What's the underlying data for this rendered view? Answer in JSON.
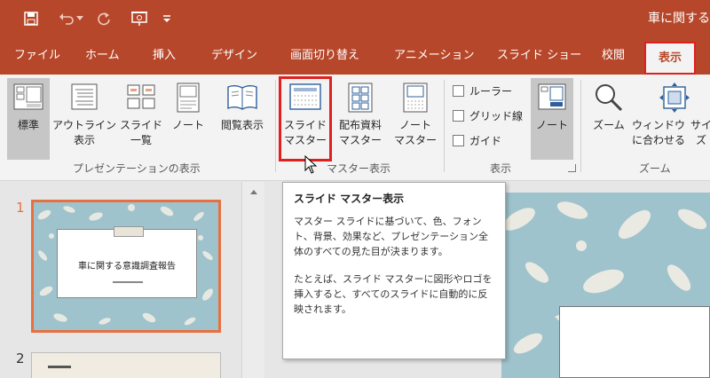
{
  "titlebar": {
    "doc_title": "車に関する",
    "qat": [
      "save-icon",
      "undo-icon",
      "redo-icon",
      "present-icon",
      "customize-icon"
    ]
  },
  "tabs": [
    {
      "label": "ファイル"
    },
    {
      "label": "ホーム"
    },
    {
      "label": "挿入"
    },
    {
      "label": "デザイン"
    },
    {
      "label": "画面切り替え"
    },
    {
      "label": "アニメーション"
    },
    {
      "label": "スライド ショー"
    },
    {
      "label": "校閲"
    },
    {
      "label": "表示",
      "active": true
    }
  ],
  "ribbon": {
    "presentation_view": {
      "label": "プレゼンテーションの表示",
      "buttons": [
        {
          "line1": "標準",
          "line2": "",
          "selected": true
        },
        {
          "line1": "アウトライン",
          "line2": "表示"
        },
        {
          "line1": "スライド",
          "line2": "一覧"
        },
        {
          "line1": "ノート",
          "line2": ""
        },
        {
          "line1": "閲覧表示",
          "line2": ""
        }
      ]
    },
    "master_view": {
      "label": "マスター表示",
      "buttons": [
        {
          "line1": "スライド",
          "line2": "マスター",
          "highlight": true
        },
        {
          "line1": "配布資料",
          "line2": "マスター"
        },
        {
          "line1": "ノート",
          "line2": "マスター"
        }
      ]
    },
    "show": {
      "label": "表示",
      "checkboxes": [
        "ルーラー",
        "グリッド線",
        "ガイド"
      ],
      "notes_button": "ノート"
    },
    "zoom": {
      "label": "ズーム",
      "zoom_button": "ズーム",
      "fit_line1": "ウィンドウ",
      "fit_line2": "に合わせる",
      "extra_line1": "サイ",
      "extra_line2": "ズ"
    }
  },
  "thumbnails": {
    "slide1_num": "1",
    "slide1_title": "車に関する意識調査報告",
    "slide2_num": "2"
  },
  "tooltip": {
    "title": "スライド マスター表示",
    "body1": "マスター スライドに基づいて、色、フォント、背景、効果など、プレゼンテーション全体のすべての見た目が決まります。",
    "body2": "たとえば、スライド マスターに図形やロゴを挿入すると、すべてのスライドに自動的に反映されます。"
  },
  "colors": {
    "accent": "#b7472a",
    "highlight_border": "#e0201f",
    "slide_bg": "#9ec3cc"
  }
}
